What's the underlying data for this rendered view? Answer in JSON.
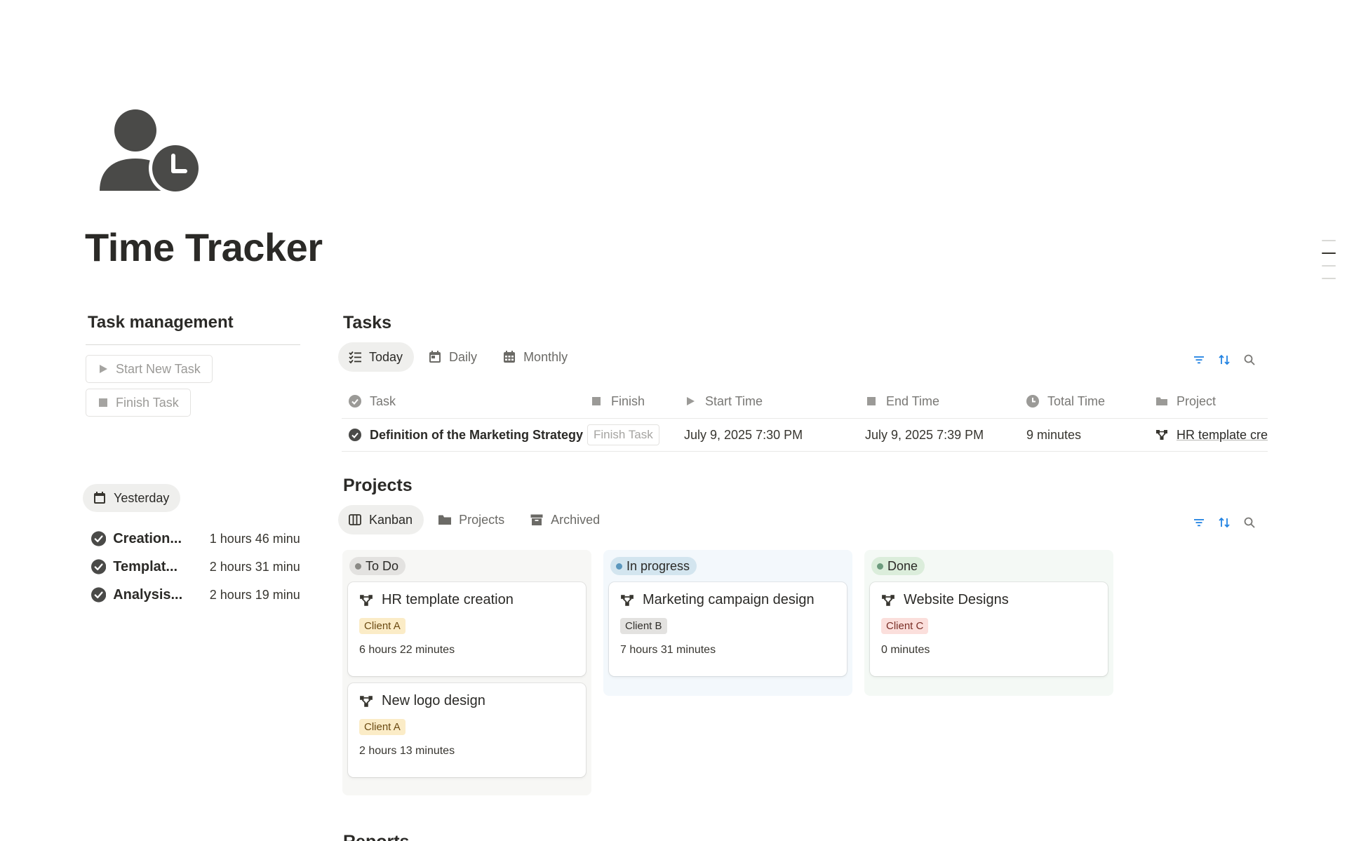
{
  "page": {
    "title": "Time Tracker",
    "icon": "person-clock-icon"
  },
  "task_management": {
    "heading": "Task management",
    "start_button": "Start New Task",
    "finish_button": "Finish Task"
  },
  "yesterday": {
    "label": "Yesterday",
    "items": [
      {
        "name": "Creation...",
        "time": "1 hours 46 minu"
      },
      {
        "name": "Templat...",
        "time": "2 hours 31 minu"
      },
      {
        "name": "Analysis...",
        "time": "2 hours 19 minu"
      }
    ]
  },
  "tasks": {
    "heading": "Tasks",
    "tabs": [
      {
        "label": "Today",
        "icon": "checklist-icon",
        "active": true
      },
      {
        "label": "Daily",
        "icon": "calendar-day-icon",
        "active": false
      },
      {
        "label": "Monthly",
        "icon": "calendar-grid-icon",
        "active": false
      }
    ],
    "columns": [
      "Task",
      "Finish",
      "Start Time",
      "End Time",
      "Total Time",
      "Project"
    ],
    "rows": [
      {
        "task": "Definition of the Marketing Strategy",
        "finish": "Finish Task",
        "start": "July 9, 2025 7:30 PM",
        "end": "July 9, 2025 7:39 PM",
        "total": "9 minutes",
        "project": "HR template creation"
      }
    ]
  },
  "projects": {
    "heading": "Projects",
    "tabs": [
      {
        "label": "Kanban",
        "icon": "board-icon",
        "active": true
      },
      {
        "label": "Projects",
        "icon": "folder-icon",
        "active": false
      },
      {
        "label": "Archived",
        "icon": "archive-icon",
        "active": false
      }
    ],
    "columns": [
      {
        "status": "To Do",
        "cards": [
          {
            "title": "HR template creation",
            "client": "Client A",
            "time": "6 hours 22 minutes"
          },
          {
            "title": "New logo design",
            "client": "Client A",
            "time": "2 hours 13 minutes"
          }
        ]
      },
      {
        "status": "In progress",
        "cards": [
          {
            "title": "Marketing campaign design",
            "client": "Client B",
            "time": "7 hours 31 minutes"
          }
        ]
      },
      {
        "status": "Done",
        "cards": [
          {
            "title": "Website Designs",
            "client": "Client C",
            "time": "0 minutes"
          }
        ]
      }
    ]
  },
  "reports": {
    "heading": "Reports"
  },
  "colors": {
    "accent": "#2383e2",
    "text": "#37352f",
    "muted": "#787774"
  }
}
